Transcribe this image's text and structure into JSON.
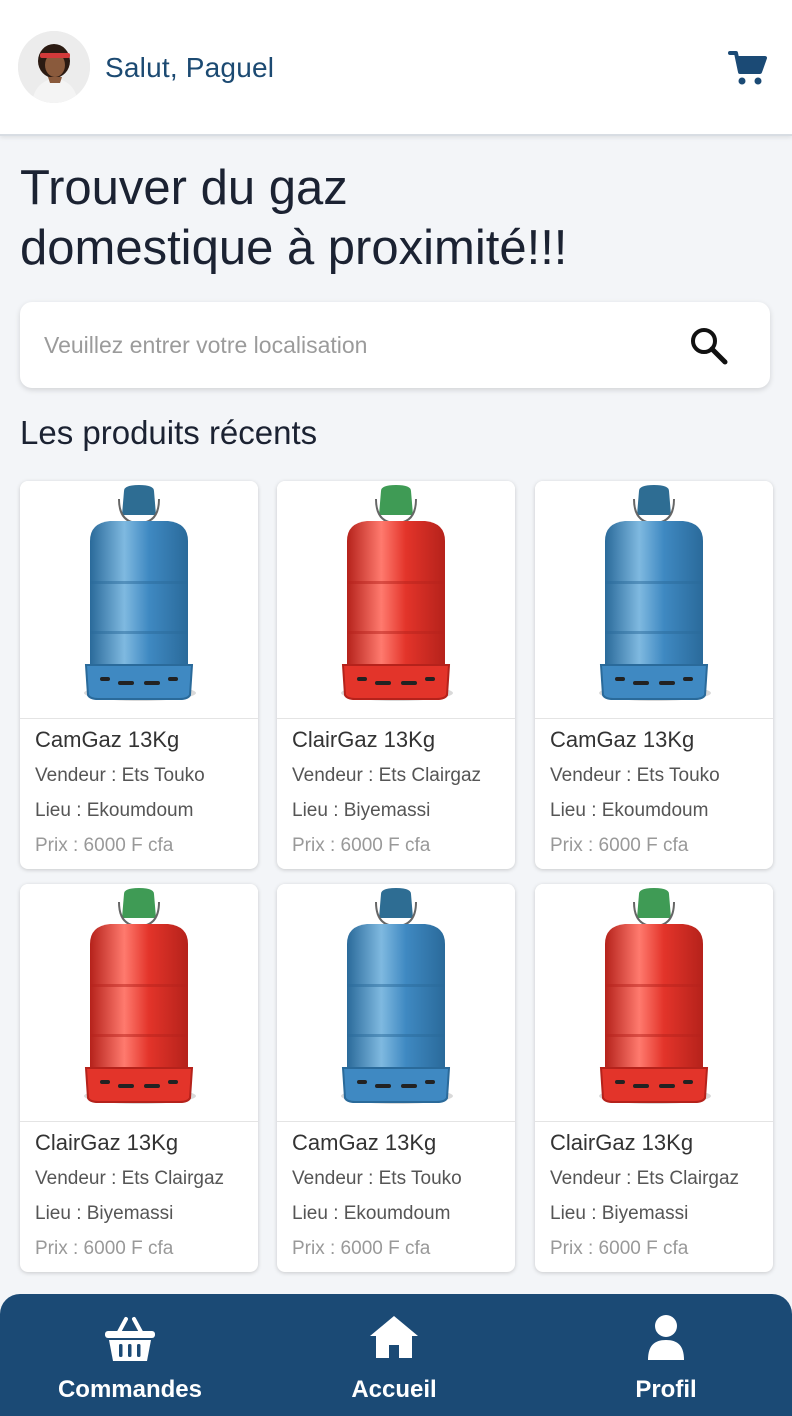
{
  "header": {
    "greeting": "Salut, Paguel",
    "avatar": "user-avatar",
    "cart_icon": "shopping-cart-icon"
  },
  "hero": {
    "line1": "Trouver du gaz",
    "line2": "domestique à proximité!!!"
  },
  "search": {
    "placeholder": "Veuillez entrer votre localisation",
    "icon": "search-icon"
  },
  "recent": {
    "title": "Les produits récents",
    "products": [
      {
        "name": "CamGaz 13Kg",
        "seller": "Vendeur : Ets Touko",
        "place": "Lieu : Ekoumdoum",
        "price": "Prix : 6000 F cfa",
        "color": "blue"
      },
      {
        "name": "ClairGaz 13Kg",
        "seller": "Vendeur : Ets Clairgaz",
        "place": "Lieu : Biyemassi",
        "price": "Prix : 6000 F cfa",
        "color": "red"
      },
      {
        "name": "CamGaz 13Kg",
        "seller": "Vendeur : Ets Touko",
        "place": "Lieu : Ekoumdoum",
        "price": "Prix : 6000 F cfa",
        "color": "blue"
      },
      {
        "name": "ClairGaz 13Kg",
        "seller": "Vendeur : Ets Clairgaz",
        "place": "Lieu : Biyemassi",
        "price": "Prix : 6000 F cfa",
        "color": "red"
      },
      {
        "name": "CamGaz 13Kg",
        "seller": "Vendeur : Ets Touko",
        "place": "Lieu : Ekoumdoum",
        "price": "Prix : 6000 F cfa",
        "color": "blue"
      },
      {
        "name": "ClairGaz 13Kg",
        "seller": "Vendeur : Ets Clairgaz",
        "place": "Lieu : Biyemassi",
        "price": "Prix : 6000 F cfa",
        "color": "red"
      }
    ]
  },
  "nav": {
    "items": [
      {
        "label": "Commandes",
        "icon": "basket-icon"
      },
      {
        "label": "Accueil",
        "icon": "home-icon"
      },
      {
        "label": "Profil",
        "icon": "user-icon"
      }
    ]
  },
  "colors": {
    "primary": "#1b4a75",
    "greeting": "#1c4a72",
    "heading": "#1b2232",
    "background": "#f3f5f8",
    "blue_bottle": "#3f89c2",
    "red_bottle": "#e3342a",
    "green_valve": "#3f9b55"
  }
}
